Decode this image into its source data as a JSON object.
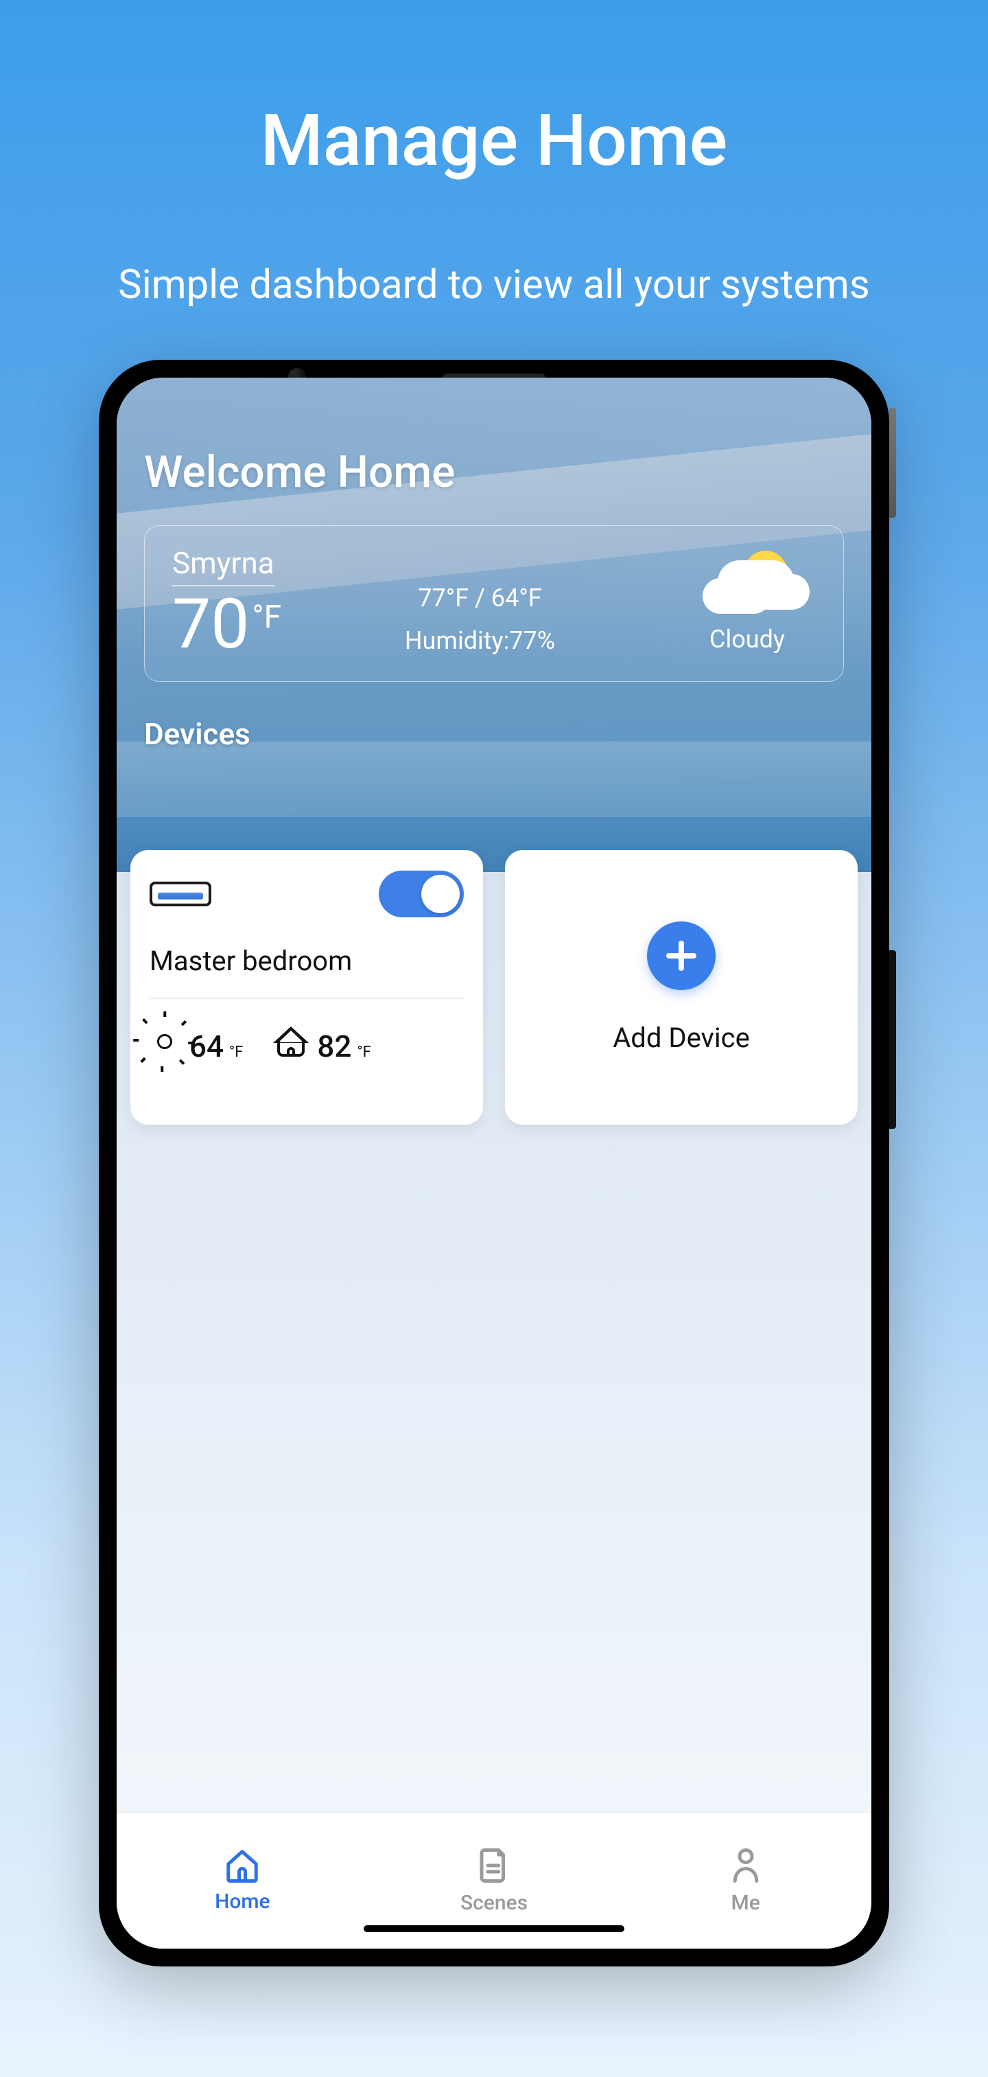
{
  "promo": {
    "title": "Manage Home",
    "subtitle": "Simple dashboard to view all your systems"
  },
  "header": {
    "welcome": "Welcome Home"
  },
  "weather": {
    "location": "Smyrna",
    "temp": "70",
    "temp_unit": "°F",
    "hi_lo": "77°F / 64°F",
    "humidity": "Humidity:77%",
    "condition": "Cloudy"
  },
  "sections": {
    "devices_title": "Devices"
  },
  "devices": [
    {
      "name": "Master bedroom",
      "on": true,
      "outside_temp": "64",
      "outside_unit": "°F",
      "inside_temp": "82",
      "inside_unit": "°F"
    }
  ],
  "add_device": {
    "label": "Add Device"
  },
  "tabs": {
    "home": "Home",
    "scenes": "Scenes",
    "me": "Me"
  }
}
